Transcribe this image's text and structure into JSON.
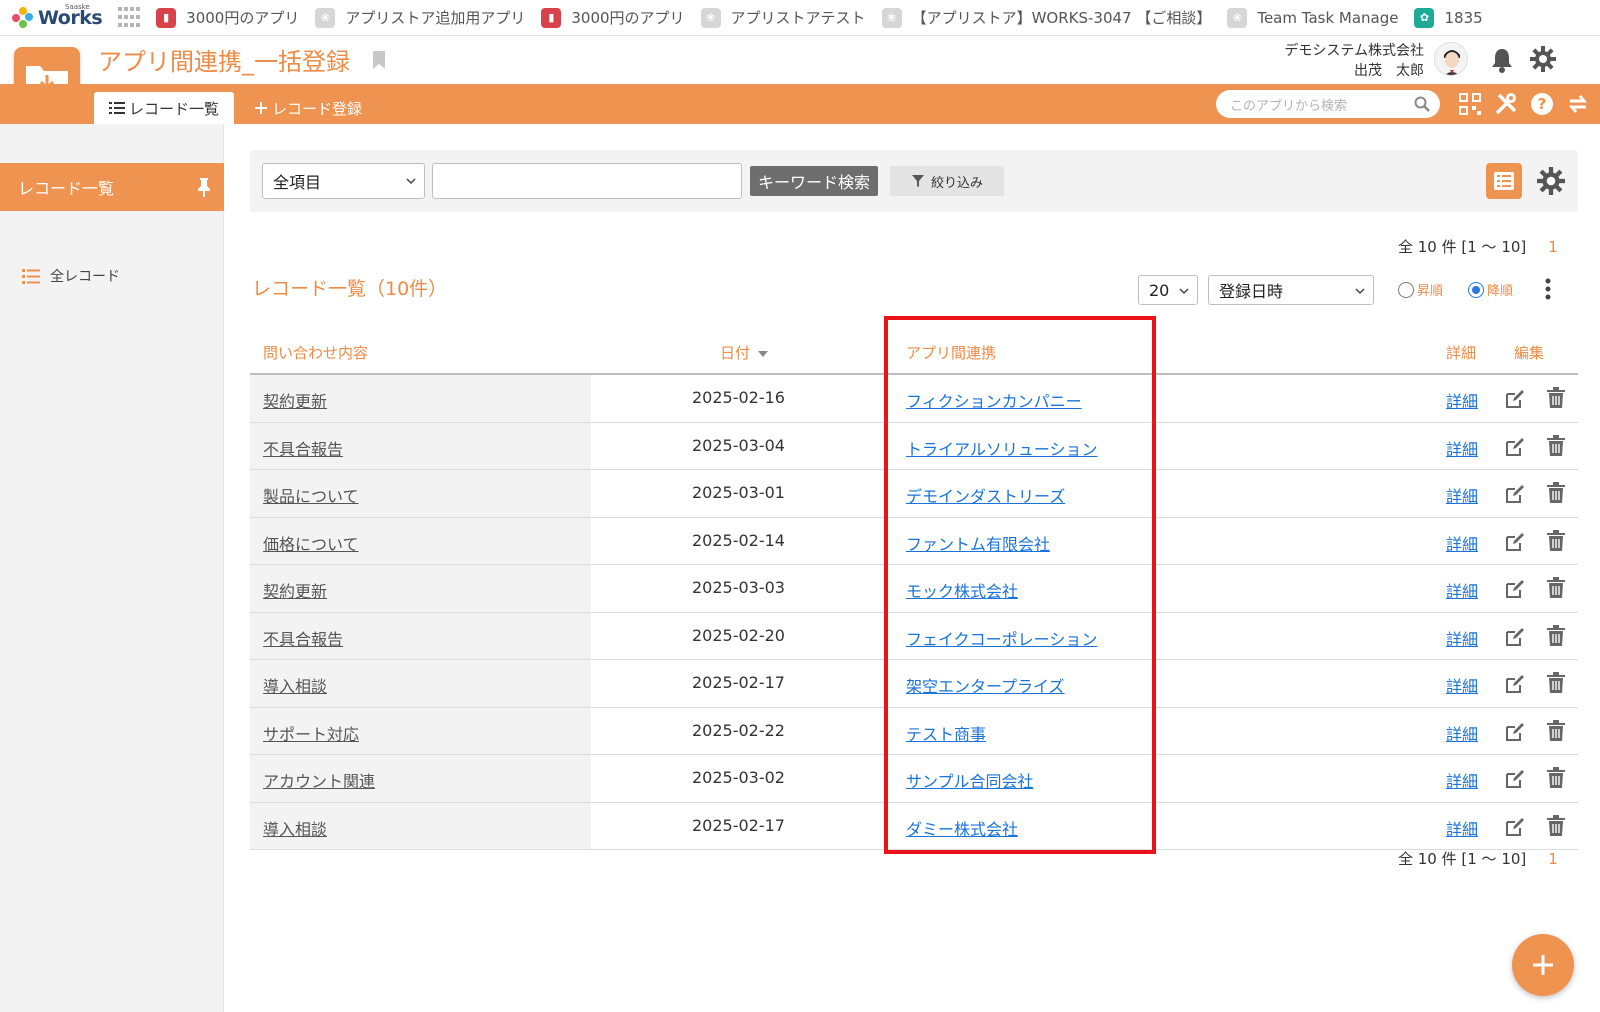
{
  "bookmarks": [
    {
      "label": "3000円のアプリ",
      "icon": "app-red-icon"
    },
    {
      "label": "アプリストア追加用アプリ",
      "icon": "app-gray-icon"
    },
    {
      "label": "3000円のアプリ",
      "icon": "app-red-icon"
    },
    {
      "label": "アプリストアテスト",
      "icon": "app-gray-icon"
    },
    {
      "label": "【アプリストア】WORKS-3047 【ご相談】",
      "icon": "app-gray-icon"
    },
    {
      "label": "Team Task Manage",
      "icon": "app-gray-icon"
    },
    {
      "label": "1835",
      "icon": "app-teal-icon"
    }
  ],
  "logo": {
    "text": "Works",
    "sup": "Saaske"
  },
  "header": {
    "app_title": "アプリ間連携_一括登録",
    "company": "デモシステム株式会社",
    "user": "出茂　太郎"
  },
  "nav": {
    "tab_list": "レコード一覧",
    "tab_add": "レコード登録",
    "search_placeholder": "このアプリから検索"
  },
  "sidebar": {
    "active": "レコード一覧",
    "items": [
      {
        "label": "全レコード"
      }
    ]
  },
  "filter": {
    "field_select": "全項目",
    "keyword_value": "",
    "search_button": "キーワード検索",
    "filter_button": "絞り込み"
  },
  "pager_top": {
    "summary": "全 10 件 [1 〜 10]",
    "page": "1"
  },
  "pager_bottom": {
    "summary": "全 10 件 [1 〜 10]",
    "page": "1"
  },
  "list": {
    "title": "レコード一覧（10件）",
    "per_page": "20",
    "sort_field": "登録日時",
    "asc_label": "昇順",
    "desc_label": "降順",
    "sort_order": "desc"
  },
  "table": {
    "headers": {
      "inquiry": "問い合わせ内容",
      "date": "日付",
      "related": "アプリ間連携",
      "detail": "詳細",
      "edit": "編集"
    },
    "rows": [
      {
        "inquiry": "契約更新",
        "date": "2025-02-16",
        "related": "フィクションカンパニー",
        "detail": "詳細"
      },
      {
        "inquiry": "不具合報告",
        "date": "2025-03-04",
        "related": "トライアルソリューション",
        "detail": "詳細"
      },
      {
        "inquiry": "製品について",
        "date": "2025-03-01",
        "related": "デモインダストリーズ",
        "detail": "詳細"
      },
      {
        "inquiry": "価格について",
        "date": "2025-02-14",
        "related": "ファントム有限会社",
        "detail": "詳細"
      },
      {
        "inquiry": "契約更新",
        "date": "2025-03-03",
        "related": "モック株式会社",
        "detail": "詳細"
      },
      {
        "inquiry": "不具合報告",
        "date": "2025-02-20",
        "related": "フェイクコーポレーション",
        "detail": "詳細"
      },
      {
        "inquiry": "導入相談",
        "date": "2025-02-17",
        "related": "架空エンタープライズ",
        "detail": "詳細"
      },
      {
        "inquiry": "サポート対応",
        "date": "2025-02-22",
        "related": "テスト商事",
        "detail": "詳細"
      },
      {
        "inquiry": "アカウント関連",
        "date": "2025-03-02",
        "related": "サンプル合同会社",
        "detail": "詳細"
      },
      {
        "inquiry": "導入相談",
        "date": "2025-02-17",
        "related": "ダミー株式会社",
        "detail": "詳細"
      }
    ]
  },
  "colors": {
    "accent": "#ef9350",
    "link": "#1a73d9",
    "highlight": "#e8141a"
  }
}
